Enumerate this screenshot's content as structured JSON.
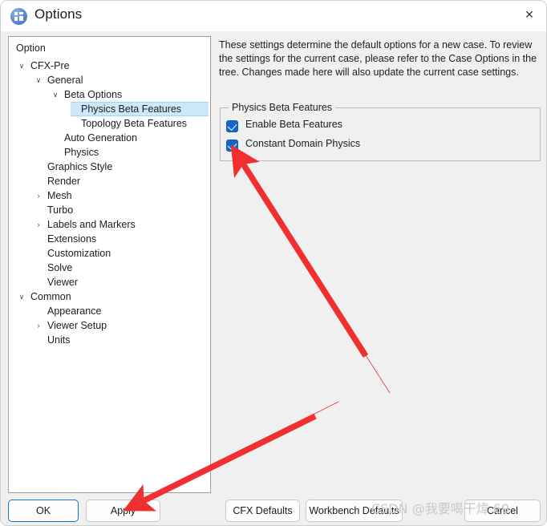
{
  "window": {
    "title": "Options",
    "app_icon": "options-window-icon",
    "close_icon": "✕"
  },
  "tree": {
    "header": "Option",
    "expand_icon": "∨",
    "collapse_icon": "›",
    "selected": "Physics Beta Features",
    "items": [
      {
        "label": "CFX-Pre",
        "depth": 0,
        "twisty": "expanded",
        "selected": false
      },
      {
        "label": "General",
        "depth": 1,
        "twisty": "expanded",
        "selected": false
      },
      {
        "label": "Beta Options",
        "depth": 2,
        "twisty": "expanded",
        "selected": false
      },
      {
        "label": "Physics Beta Features",
        "depth": 3,
        "twisty": "none",
        "selected": true
      },
      {
        "label": "Topology Beta Features",
        "depth": 3,
        "twisty": "none",
        "selected": false
      },
      {
        "label": "Auto Generation",
        "depth": 2,
        "twisty": "none",
        "selected": false
      },
      {
        "label": "Physics",
        "depth": 2,
        "twisty": "none",
        "selected": false
      },
      {
        "label": "Graphics Style",
        "depth": 1,
        "twisty": "none",
        "selected": false
      },
      {
        "label": "Render",
        "depth": 1,
        "twisty": "none",
        "selected": false
      },
      {
        "label": "Mesh",
        "depth": 1,
        "twisty": "collapsed",
        "selected": false
      },
      {
        "label": "Turbo",
        "depth": 1,
        "twisty": "none",
        "selected": false
      },
      {
        "label": "Labels and Markers",
        "depth": 1,
        "twisty": "collapsed",
        "selected": false
      },
      {
        "label": "Extensions",
        "depth": 1,
        "twisty": "none",
        "selected": false
      },
      {
        "label": "Customization",
        "depth": 1,
        "twisty": "none",
        "selected": false
      },
      {
        "label": "Solve",
        "depth": 1,
        "twisty": "none",
        "selected": false
      },
      {
        "label": "Viewer",
        "depth": 1,
        "twisty": "none",
        "selected": false
      },
      {
        "label": "Common",
        "depth": 0,
        "twisty": "expanded",
        "selected": false
      },
      {
        "label": "Appearance",
        "depth": 1,
        "twisty": "none",
        "selected": false
      },
      {
        "label": "Viewer Setup",
        "depth": 1,
        "twisty": "collapsed",
        "selected": false
      },
      {
        "label": "Units",
        "depth": 1,
        "twisty": "none",
        "selected": false
      }
    ]
  },
  "main": {
    "description": "These settings determine the default options for a new case. To review the settings for the current case, please refer to the Case Options in the tree. Changes made here will also update the current case settings.",
    "group": {
      "legend": "Physics Beta Features",
      "checkboxes": [
        {
          "label": "Enable Beta Features",
          "checked": true
        },
        {
          "label": "Constant Domain Physics",
          "checked": true
        }
      ]
    }
  },
  "buttons": {
    "ok": "OK",
    "apply": "Apply",
    "cfx_defaults": "CFX Defaults",
    "workbench_defaults": "Workbench Defaults",
    "cancel": "Cancel"
  },
  "annotations": {
    "arrow_color": "#f03030",
    "arrow_1_target": "Constant Domain Physics checkbox",
    "arrow_2_target": "Apply button"
  },
  "watermark": {
    "text": "CSDN @我要喝干煒 69"
  },
  "colors": {
    "accent": "#1367c8",
    "selection": "#cde8fa",
    "default_button_border": "#1972c4",
    "window_bg": "#f0f0f0"
  }
}
